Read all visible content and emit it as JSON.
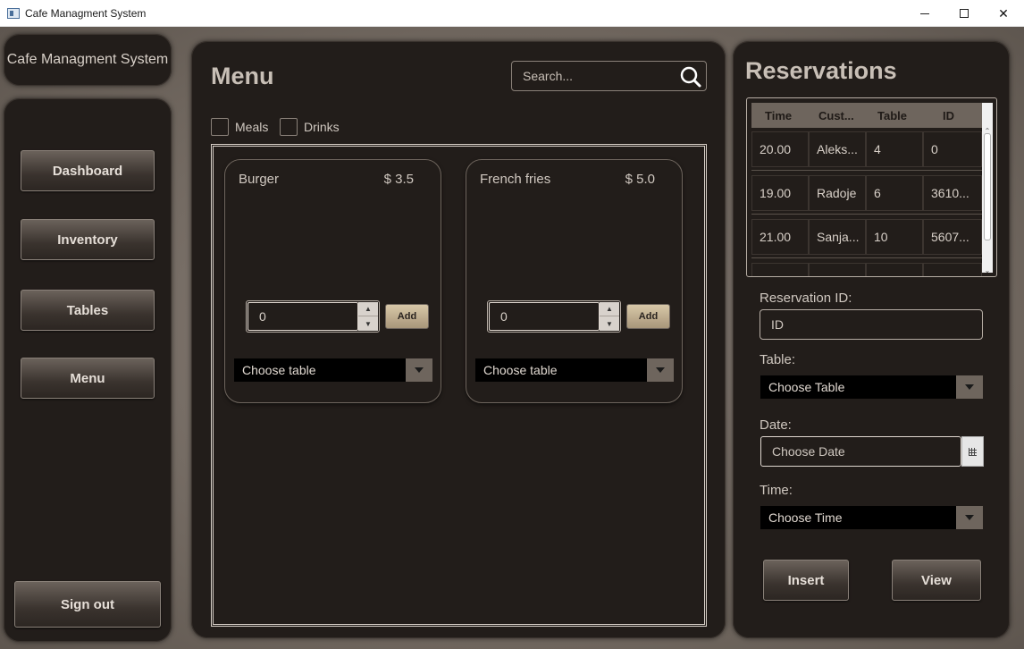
{
  "window": {
    "title": "Cafe Managment System"
  },
  "brand": {
    "title": "Cafe Managment System"
  },
  "sidebar": {
    "items": [
      {
        "label": "Dashboard"
      },
      {
        "label": "Inventory"
      },
      {
        "label": "Tables"
      },
      {
        "label": "Menu"
      }
    ],
    "signout": "Sign out"
  },
  "menu": {
    "title": "Menu",
    "search_placeholder": "Search...",
    "filters": [
      {
        "label": "Meals",
        "checked": false
      },
      {
        "label": "Drinks",
        "checked": false
      }
    ],
    "items": [
      {
        "name": "Burger",
        "price": "$ 3.5",
        "quantity": "0",
        "add_label": "Add",
        "table_placeholder": "Choose table"
      },
      {
        "name": "French fries",
        "price": "$ 5.0",
        "quantity": "0",
        "add_label": "Add",
        "table_placeholder": "Choose table"
      }
    ]
  },
  "reservations": {
    "title": "Reservations",
    "columns": [
      "Time",
      "Cust...",
      "Table",
      "ID"
    ],
    "rows": [
      [
        "20.00",
        "Aleks...",
        "4",
        "0"
      ],
      [
        "19.00",
        "Radoje",
        "6",
        "3610..."
      ],
      [
        "21.00",
        "Sanja...",
        "10",
        "5607..."
      ]
    ],
    "id_label": "Reservation ID:",
    "id_placeholder": "ID",
    "table_label": "Table:",
    "table_placeholder": "Choose Table",
    "date_label": "Date:",
    "date_placeholder": "Choose Date",
    "time_label": "Time:",
    "time_placeholder": "Choose Time",
    "insert_label": "Insert",
    "view_label": "View"
  }
}
